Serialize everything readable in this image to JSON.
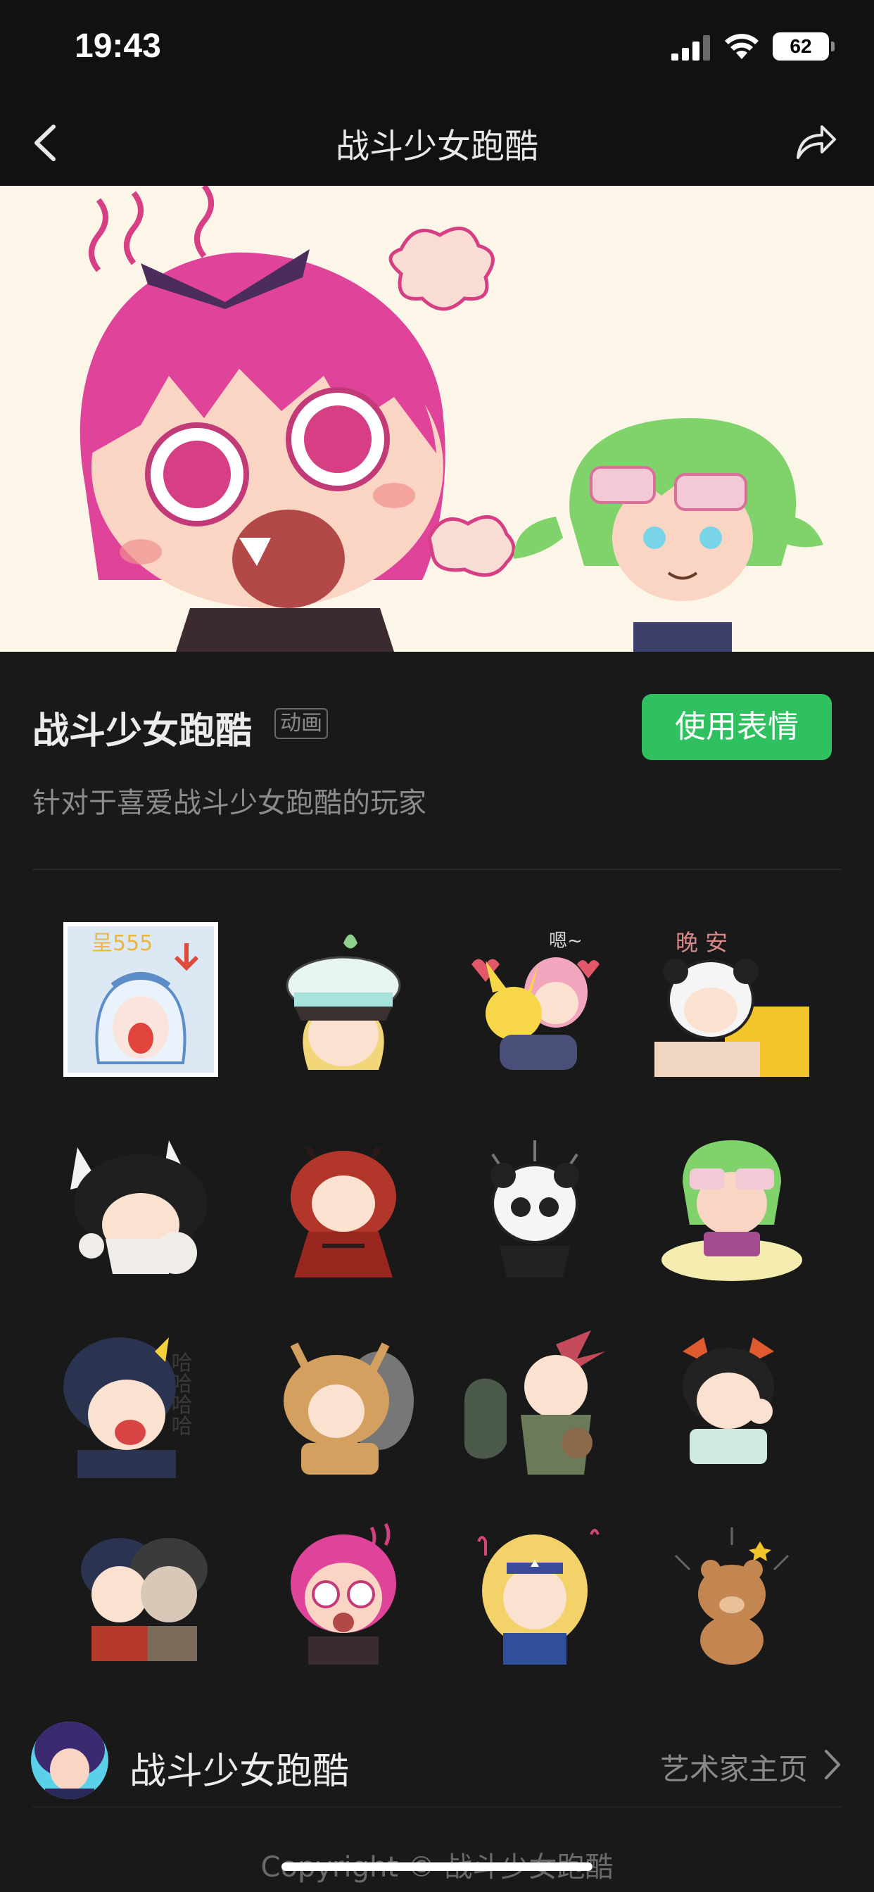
{
  "status": {
    "time": "19:43",
    "battery": "62"
  },
  "nav": {
    "title": "战斗少女跑酷"
  },
  "pack": {
    "title": "战斗少女跑酷",
    "tag": "动画",
    "use_button": "使用表情",
    "description": "针对于喜爱战斗少女跑酷的玩家"
  },
  "stickers": [
    {
      "name": "crying-girl-555",
      "text": "呈555"
    },
    {
      "name": "captain-hat-girl"
    },
    {
      "name": "pink-hair-hug-pikachu",
      "text": "嗯~"
    },
    {
      "name": "panda-hood-good-night",
      "text": "晚 安"
    },
    {
      "name": "cat-ear-girl"
    },
    {
      "name": "red-horn-girl"
    },
    {
      "name": "panda-costume"
    },
    {
      "name": "green-hair-gaming"
    },
    {
      "name": "laughing-girl-haha",
      "text": "哈哈哈哈"
    },
    {
      "name": "squirrel-costume"
    },
    {
      "name": "punching-girl"
    },
    {
      "name": "cow-ear-girl"
    },
    {
      "name": "twin-black-hair"
    },
    {
      "name": "pink-hair-shocked"
    },
    {
      "name": "blonde-singing"
    },
    {
      "name": "brown-bear"
    }
  ],
  "artist": {
    "name": "战斗少女跑酷",
    "link_label": "艺术家主页"
  },
  "footer": {
    "copyright": "Copyright © 战斗少女跑酷"
  },
  "colors": {
    "accent": "#2fc160",
    "background": "#191919"
  }
}
